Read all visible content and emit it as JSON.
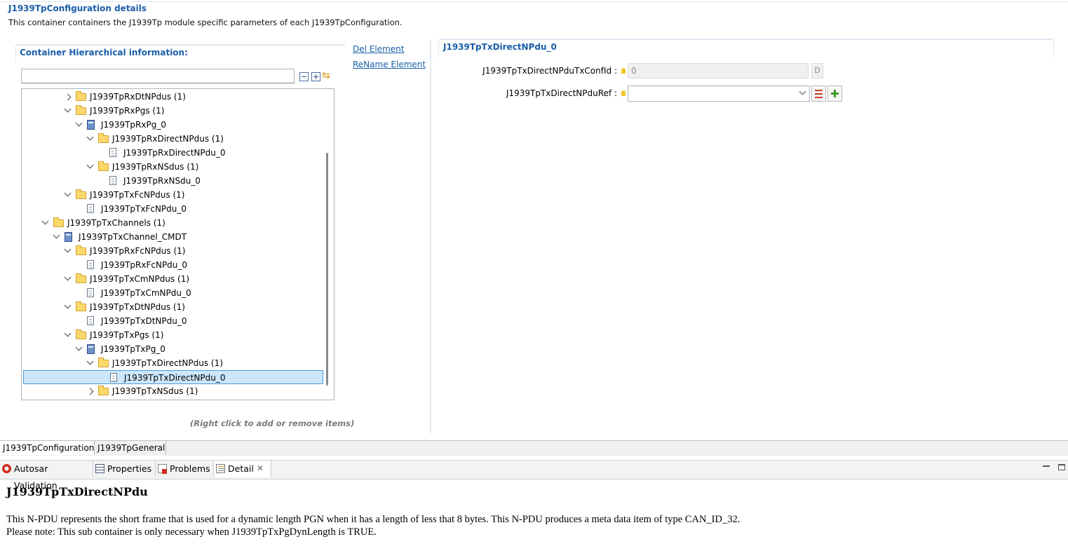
{
  "header": {
    "title": "J1939TpConfiguration details",
    "description": "This container containers the J1939Tp module specific parameters of each J1939TpConfiguration."
  },
  "left_panel": {
    "title": "Container Hierarchical information:",
    "del_element": "Del Element",
    "rename_element": "ReName Element",
    "filter_value": "",
    "hint": "(Right click to add or remove items)",
    "tree": [
      {
        "label": "J1939TpRxDtNPdus (1)",
        "depth": 2,
        "icon": "folder",
        "state": "closed"
      },
      {
        "label": "J1939TpRxPgs (1)",
        "depth": 2,
        "icon": "folder",
        "state": "open"
      },
      {
        "label": "J1939TpRxPg_0",
        "depth": 3,
        "icon": "container",
        "state": "open"
      },
      {
        "label": "J1939TpRxDirectNPdus (1)",
        "depth": 4,
        "icon": "folder",
        "state": "open"
      },
      {
        "label": "J1939TpRxDirectNPdu_0",
        "depth": 5,
        "icon": "doc",
        "state": "none"
      },
      {
        "label": "J1939TpRxNSdus (1)",
        "depth": 4,
        "icon": "folder",
        "state": "open"
      },
      {
        "label": "J1939TpRxNSdu_0",
        "depth": 5,
        "icon": "doc",
        "state": "none"
      },
      {
        "label": "J1939TpTxFcNPdus (1)",
        "depth": 2,
        "icon": "folder",
        "state": "open"
      },
      {
        "label": "J1939TpTxFcNPdu_0",
        "depth": 3,
        "icon": "doc",
        "state": "none"
      },
      {
        "label": "J1939TpTxChannels (1)",
        "depth": 0,
        "icon": "folder",
        "state": "open"
      },
      {
        "label": "J1939TpTxChannel_CMDT",
        "depth": 1,
        "icon": "container",
        "state": "open"
      },
      {
        "label": "J1939TpRxFcNPdus (1)",
        "depth": 2,
        "icon": "folder",
        "state": "open"
      },
      {
        "label": "J1939TpRxFcNPdu_0",
        "depth": 3,
        "icon": "doc",
        "state": "none"
      },
      {
        "label": "J1939TpTxCmNPdus (1)",
        "depth": 2,
        "icon": "folder",
        "state": "open"
      },
      {
        "label": "J1939TpTxCmNPdu_0",
        "depth": 3,
        "icon": "doc",
        "state": "none"
      },
      {
        "label": "J1939TpTxDtNPdus (1)",
        "depth": 2,
        "icon": "folder",
        "state": "open"
      },
      {
        "label": "J1939TpTxDtNPdu_0",
        "depth": 3,
        "icon": "doc",
        "state": "none"
      },
      {
        "label": "J1939TpTxPgs (1)",
        "depth": 2,
        "icon": "folder",
        "state": "open"
      },
      {
        "label": "J1939TpTxPg_0",
        "depth": 3,
        "icon": "container",
        "state": "open"
      },
      {
        "label": "J1939TpTxDirectNPdus (1)",
        "depth": 4,
        "icon": "folder",
        "state": "open"
      },
      {
        "label": "J1939TpTxDirectNPdu_0",
        "depth": 5,
        "icon": "doc",
        "state": "none",
        "selected": true
      },
      {
        "label": "J1939TpTxNSdus (1)",
        "depth": 4,
        "icon": "folder",
        "state": "closed"
      }
    ]
  },
  "right_panel": {
    "title": "J1939TpTxDirectNPdu_0",
    "fields": {
      "conf_id_label": "J1939TpTxDirectNPduTxConfId :",
      "conf_id_value": "0",
      "conf_id_default_btn": "D",
      "ref_label": "J1939TpTxDirectNPduRef :",
      "ref_value": ""
    }
  },
  "editor_tabs": [
    "J1939TpConfiguration",
    "J1939TpGeneral"
  ],
  "view_tabs": {
    "autosar_validation": "Autosar Validation",
    "properties": "Properties",
    "problems": "Problems",
    "detail": "Detail"
  },
  "detail": {
    "title": "J1939TpTxDirectNPdu",
    "line1": "This N-PDU represents the short frame that is used for a dynamic length PGN when it has a length of less that 8 bytes. This N-PDU produces a meta data item of type CAN_ID_32.",
    "line2": "Please note: This sub container is only necessary when J1939TpTxPgDynLength is TRUE."
  },
  "colors": {
    "accent": "#1a5ea8",
    "selection": "#cce6fb",
    "folder": "#fbd86b"
  }
}
